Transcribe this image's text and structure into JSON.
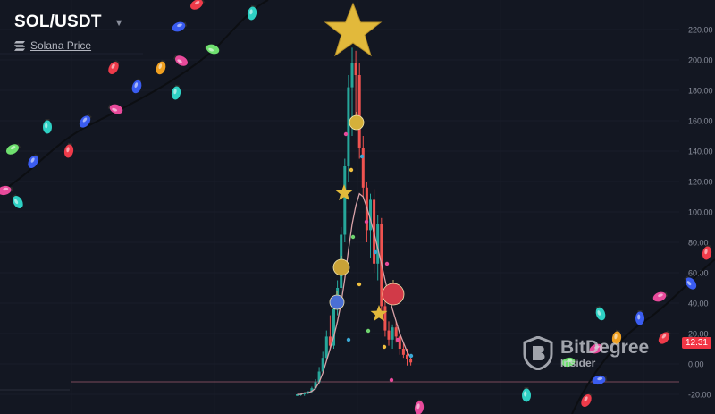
{
  "header": {
    "pair": "SOL/USDT",
    "subtitle": "Solana Price"
  },
  "price_tag": "12.31",
  "brand": {
    "name": "BitDegree",
    "tagline": "Insider"
  },
  "colors": {
    "background": "#131722",
    "up": "#26a69a",
    "down": "#ef5350",
    "ma": "#d8a2a8",
    "axis_text": "#8a8f9c",
    "price_tag": "#f23645",
    "baseline": "#7a4a5a"
  },
  "icons": [
    "chevron-down-icon",
    "solana-logo-icon",
    "bitdegree-shield-icon",
    "christmas-star-icon",
    "ornament-icon",
    "string-light-icon"
  ],
  "chart_data": {
    "type": "candlestick",
    "y_axis": {
      "side": "right",
      "ticks": [
        220,
        200,
        180,
        160,
        140,
        120,
        100,
        80,
        60,
        40,
        20,
        0,
        -20
      ],
      "tick_labels": [
        "220.00",
        "200.00",
        "180.00",
        "160.00",
        "140.00",
        "120.00",
        "100.00",
        "80.00",
        "60.00",
        "40.00",
        "20.00",
        "0.00",
        "-20.00"
      ],
      "ylim": [
        -24,
        238
      ]
    },
    "current_price": 12.31,
    "baseline": 0,
    "grid": true,
    "candles": [
      {
        "o": -21,
        "h": -20,
        "l": -21,
        "c": -20
      },
      {
        "o": -20,
        "h": -19,
        "l": -21,
        "c": -20
      },
      {
        "o": -20,
        "h": -19,
        "l": -21,
        "c": -19
      },
      {
        "o": -19,
        "h": -18,
        "l": -20,
        "c": -18
      },
      {
        "o": -18,
        "h": -15,
        "l": -19,
        "c": -16
      },
      {
        "o": -16,
        "h": -10,
        "l": -17,
        "c": -12
      },
      {
        "o": -12,
        "h": -2,
        "l": -13,
        "c": -5
      },
      {
        "o": -5,
        "h": 8,
        "l": -6,
        "c": 4
      },
      {
        "o": 4,
        "h": 22,
        "l": 2,
        "c": 18
      },
      {
        "o": 18,
        "h": 32,
        "l": 10,
        "c": 12
      },
      {
        "o": 12,
        "h": 40,
        "l": 10,
        "c": 36
      },
      {
        "o": 36,
        "h": 55,
        "l": 32,
        "c": 50
      },
      {
        "o": 50,
        "h": 90,
        "l": 45,
        "c": 85
      },
      {
        "o": 85,
        "h": 135,
        "l": 80,
        "c": 130
      },
      {
        "o": 130,
        "h": 190,
        "l": 120,
        "c": 182
      },
      {
        "o": 182,
        "h": 208,
        "l": 150,
        "c": 198
      },
      {
        "o": 198,
        "h": 206,
        "l": 160,
        "c": 190
      },
      {
        "o": 190,
        "h": 198,
        "l": 135,
        "c": 142
      },
      {
        "o": 142,
        "h": 150,
        "l": 110,
        "c": 116
      },
      {
        "o": 116,
        "h": 120,
        "l": 80,
        "c": 88
      },
      {
        "o": 88,
        "h": 112,
        "l": 70,
        "c": 108
      },
      {
        "o": 108,
        "h": 115,
        "l": 60,
        "c": 66
      },
      {
        "o": 66,
        "h": 98,
        "l": 55,
        "c": 92
      },
      {
        "o": 92,
        "h": 96,
        "l": 30,
        "c": 38
      },
      {
        "o": 38,
        "h": 45,
        "l": 18,
        "c": 22
      },
      {
        "o": 22,
        "h": 28,
        "l": 12,
        "c": 16
      },
      {
        "o": 16,
        "h": 26,
        "l": 10,
        "c": 24
      },
      {
        "o": 24,
        "h": 28,
        "l": 14,
        "c": 18
      },
      {
        "o": 18,
        "h": 22,
        "l": 6,
        "c": 10
      },
      {
        "o": 10,
        "h": 14,
        "l": 4,
        "c": 6
      },
      {
        "o": 6,
        "h": 10,
        "l": -1,
        "c": 3
      },
      {
        "o": 3,
        "h": 6,
        "l": -1,
        "c": 1
      }
    ],
    "moving_average": [
      -20,
      -20,
      -19,
      -19,
      -18,
      -16,
      -12,
      -6,
      2,
      10,
      18,
      28,
      40,
      56,
      75,
      92,
      104,
      112,
      110,
      103,
      95,
      86,
      76,
      66,
      55,
      45,
      36,
      28,
      20,
      14,
      8,
      4
    ]
  }
}
